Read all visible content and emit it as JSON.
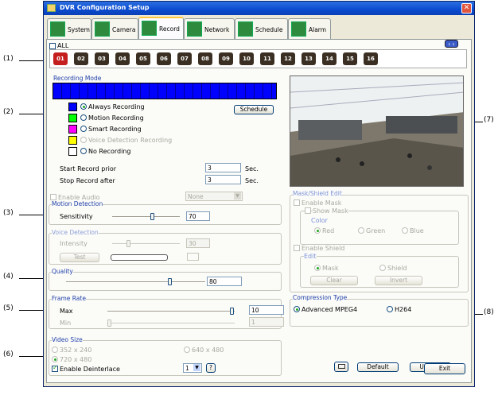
{
  "window": {
    "title": "DVR Configuration Setup"
  },
  "tabs": [
    {
      "label": "System",
      "icon": "system-icon"
    },
    {
      "label": "Camera",
      "icon": "camera-icon"
    },
    {
      "label": "Record",
      "icon": "record-icon"
    },
    {
      "label": "Network",
      "icon": "network-icon"
    },
    {
      "label": "Schedule",
      "icon": "schedule-icon"
    },
    {
      "label": "Alarm",
      "icon": "alarm-icon"
    }
  ],
  "cameras": {
    "all_label": "ALL",
    "numbers": [
      "01",
      "02",
      "03",
      "04",
      "05",
      "06",
      "07",
      "08",
      "09",
      "10",
      "11",
      "12",
      "13",
      "14",
      "15",
      "16"
    ],
    "selected": "01"
  },
  "recording_mode": {
    "title": "Recording Mode",
    "options": [
      {
        "label": "Always Recording",
        "color": "#0000ff",
        "selected": true
      },
      {
        "label": "Motion Recording",
        "color": "#00ff00"
      },
      {
        "label": "Smart Recording",
        "color": "#ff00ff"
      },
      {
        "label": "Voice Detection Recording",
        "color": "#ffff00",
        "disabled": true
      },
      {
        "label": "No Recording",
        "color": "#ffffff"
      }
    ],
    "schedule_label": "Schedule",
    "prior_label": "Start Record prior",
    "prior_value": "3",
    "after_label": "Stop Record after",
    "after_value": "3",
    "unit": "Sec."
  },
  "audio": {
    "enable_label": "Enable Audio",
    "select_value": "None"
  },
  "motion_detection": {
    "title": "Motion Detection",
    "sensitivity_label": "Sensitivity",
    "sensitivity_value": "70"
  },
  "voice_detection": {
    "title": "Voice Detection",
    "intensity_label": "Intensity",
    "intensity_value": "30",
    "test_label": "Test"
  },
  "quality": {
    "title": "Quality",
    "value": "80"
  },
  "frame_rate": {
    "title": "Frame Rate",
    "max_label": "Max",
    "max_value": "10",
    "min_label": "Min",
    "min_value": "1"
  },
  "video_size": {
    "title": "Video Size",
    "options": [
      "352 x 240",
      "640 x 480",
      "720 x 480"
    ],
    "deinterlace_label": "Enable Deinterlace",
    "select_value": "1",
    "help_label": "?"
  },
  "mask": {
    "title": "Mask/Shield Edit",
    "enable_mask": "Enable Mask",
    "show_mask": "Show Mask",
    "color_title": "Color",
    "colors": [
      "Red",
      "Green",
      "Blue"
    ],
    "enable_shield": "Enable Shield",
    "edit_title": "Edit",
    "edit_options": [
      "Mask",
      "Shield"
    ],
    "clear_label": "Clear",
    "invert_label": "Invert"
  },
  "compression": {
    "title": "Compression Type",
    "options": [
      "Advanced MPEG4",
      "H264"
    ]
  },
  "buttons": {
    "default": "Default",
    "update": "Update",
    "exit": "Exit"
  },
  "callouts": [
    "(1)",
    "(2)",
    "(3)",
    "(4)",
    "(5)",
    "(6)",
    "(7)",
    "(8)"
  ]
}
